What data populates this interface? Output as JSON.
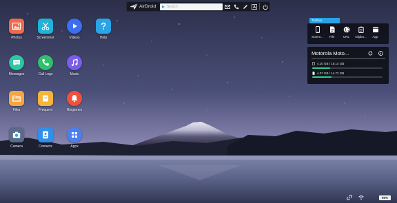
{
  "topbar": {
    "brand": "AirDroid",
    "search_placeholder": "Search",
    "icons": [
      "mail-icon",
      "phone-icon",
      "pen-icon",
      "font-icon",
      "power-icon"
    ]
  },
  "desktop": {
    "apps": [
      {
        "label": "Photos",
        "color": "#ef6a4c",
        "icon": "photos-icon"
      },
      {
        "label": "Screenshot",
        "color": "#1fb3d9",
        "icon": "scissors-icon"
      },
      {
        "label": "Videos",
        "color": "#3c6ff0",
        "icon": "play-icon"
      },
      {
        "label": "Help",
        "color": "#2aa4e6",
        "icon": "question-icon"
      },
      {
        "label": "Messages",
        "color": "#2fc7a3",
        "icon": "chat-icon"
      },
      {
        "label": "Call Logs",
        "color": "#2fc06c",
        "icon": "phone-call-icon"
      },
      {
        "label": "Music",
        "color": "#7a5ee6",
        "icon": "music-icon"
      },
      {
        "label": "Files",
        "color": "#f4a640",
        "icon": "folder-icon"
      },
      {
        "label": "Frequent",
        "color": "#f4b53a",
        "icon": "frequent-icon"
      },
      {
        "label": "Ringtones",
        "color": "#f0503e",
        "icon": "bell-icon"
      },
      {
        "label": "Camera",
        "color": "#3fa3e0",
        "icon": "camera-icon"
      },
      {
        "label": "Contacts",
        "color": "#2f8fea",
        "icon": "contacts-icon"
      },
      {
        "label": "Apps",
        "color": "#4a7ff0",
        "icon": "grid-icon"
      }
    ]
  },
  "toolbox": {
    "title": "Toolbox",
    "tools": [
      {
        "label": "Summ...",
        "icon": "phone-summary-icon"
      },
      {
        "label": "File",
        "icon": "file-icon"
      },
      {
        "label": "URL",
        "icon": "globe-icon"
      },
      {
        "label": "Clipbo...",
        "icon": "clipboard-icon"
      },
      {
        "label": "App",
        "icon": "app-icon"
      }
    ]
  },
  "device": {
    "name": "Motorola Moto...",
    "storage": [
      {
        "text": "4.10 GB / 16.14 GB",
        "percent": 25.4,
        "icon": "phone-storage-icon"
      },
      {
        "text": "4.07 GB / 14.72 GB",
        "percent": 27.6,
        "icon": "sdcard-icon"
      }
    ]
  },
  "tray": {
    "battery": "96%"
  },
  "colors": {
    "accent": "#29a3e6",
    "storage_bar": "#2fcf8a"
  }
}
